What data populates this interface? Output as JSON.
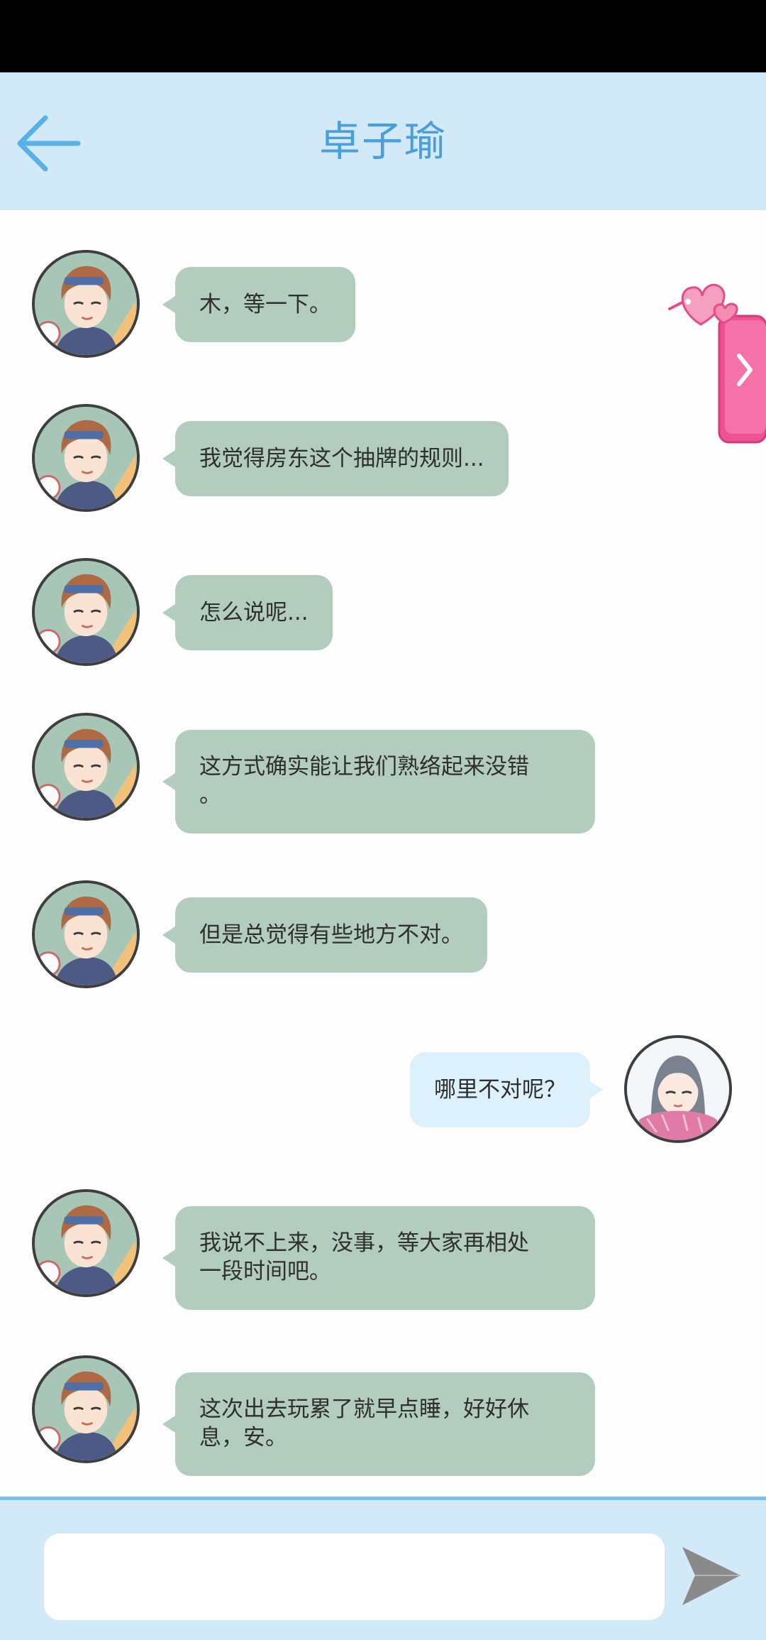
{
  "header": {
    "title": "卓子瑜",
    "back_icon": "arrow-left-icon"
  },
  "colors": {
    "header_bg": "#d2e9f8",
    "title": "#4a9fda",
    "contact_bubble": "#b2cdbe",
    "self_bubble": "#dcf1fc",
    "side_tab": "#f05a96",
    "send_icon": "#8a8a8a"
  },
  "side_tab": {
    "icon": "heart-chevron-right-icon"
  },
  "messages": [
    {
      "sender": "contact",
      "avatar": "contact-avatar",
      "text": "木，等一下。"
    },
    {
      "sender": "contact",
      "avatar": "contact-avatar",
      "text": "我觉得房东这个抽牌的规则..."
    },
    {
      "sender": "contact",
      "avatar": "contact-avatar",
      "text": "怎么说呢..."
    },
    {
      "sender": "contact",
      "avatar": "contact-avatar",
      "text": "这方式确实能让我们熟络起来没错\n。"
    },
    {
      "sender": "contact",
      "avatar": "contact-avatar",
      "text": "但是总觉得有些地方不对。"
    },
    {
      "sender": "self",
      "avatar": "self-avatar",
      "text": "哪里不对呢？"
    },
    {
      "sender": "contact",
      "avatar": "contact-avatar",
      "text": "我说不上来，没事，等大家再相处\n一段时间吧。"
    },
    {
      "sender": "contact",
      "avatar": "contact-avatar",
      "text": "这次出去玩累了就早点睡，好好休\n息，安。"
    }
  ],
  "composer": {
    "value": "",
    "placeholder": "",
    "send_icon": "send-arrow-icon"
  }
}
